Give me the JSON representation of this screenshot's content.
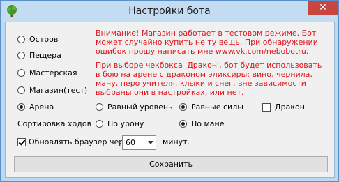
{
  "window": {
    "title": "Настройки бота",
    "close_glyph": "✕",
    "app_icon": "tree-icon",
    "close_color": "#c7463f"
  },
  "locations": [
    {
      "label": "Остров",
      "checked": false
    },
    {
      "label": "Пещера",
      "checked": false
    },
    {
      "label": "Мастерская",
      "checked": false
    },
    {
      "label": "Магазин(тест)",
      "checked": false
    },
    {
      "label": "Арена",
      "checked": true
    }
  ],
  "notices": {
    "warning": "Внимание! Магазин работает в тестовом режиме. Бот может случайно купить не ту вещь. При обнаружении ошибок прошу написать мне www.vk.com/nebobotru.",
    "dragon_info": "При выборе чекбокса 'Дракон', бот будет использовать в бою на арене с драконом эликсиры: вино, чернила, ману, перо учителя, клыки и снег, вне зависимости выбраны они в настройках, или нет.",
    "color": "#e0141a"
  },
  "arena_mode": {
    "options": [
      {
        "label": "Равный уровень",
        "checked": false
      },
      {
        "label": "Равные силы",
        "checked": true
      }
    ],
    "dragon": {
      "label": "Дракон",
      "checked": false
    }
  },
  "sort": {
    "label": "Сортировка ходов",
    "options": [
      {
        "label": "По урону",
        "checked": false
      },
      {
        "label": "По мане",
        "checked": true
      }
    ]
  },
  "refresh": {
    "label": "Обновлять браузер через",
    "checked": true,
    "value": "60",
    "unit": "минут."
  },
  "save_label": "Сохранить"
}
